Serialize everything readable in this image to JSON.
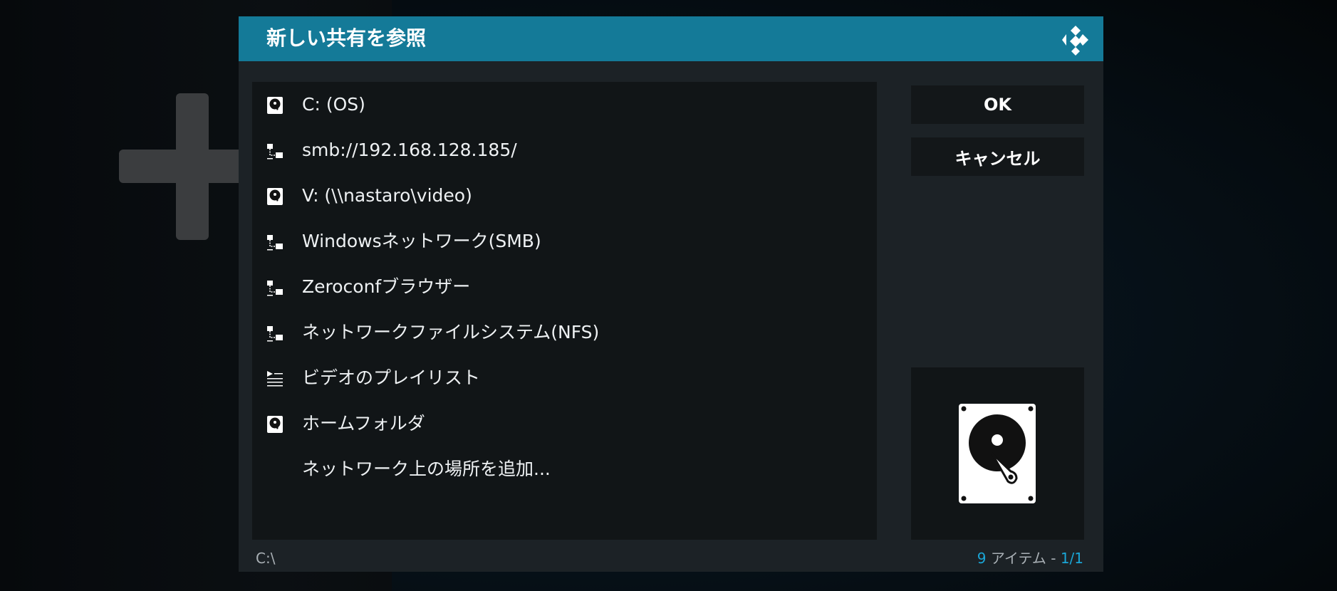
{
  "dialog": {
    "title": "新しい共有を参照",
    "logo_icon": "kodi-logo-icon"
  },
  "list": {
    "items": [
      {
        "label": "C: (OS)",
        "icon": "hard-drive-icon"
      },
      {
        "label": "smb://192.168.128.185/",
        "icon": "network-icon"
      },
      {
        "label": "V: (\\\\nastaro\\video)",
        "icon": "hard-drive-icon"
      },
      {
        "label": "Windowsネットワーク(SMB)",
        "icon": "network-icon"
      },
      {
        "label": "Zeroconfブラウザー",
        "icon": "network-icon"
      },
      {
        "label": "ネットワークファイルシステム(NFS)",
        "icon": "network-icon"
      },
      {
        "label": "ビデオのプレイリスト",
        "icon": "playlist-icon"
      },
      {
        "label": "ホームフォルダ",
        "icon": "hard-drive-icon"
      },
      {
        "label": "ネットワーク上の場所を追加...",
        "icon": ""
      }
    ]
  },
  "buttons": {
    "ok_label": "OK",
    "cancel_label": "キャンセル"
  },
  "preview": {
    "icon": "hard-drive-icon"
  },
  "footer": {
    "path": "C:\\",
    "count_number": "9",
    "count_text": " アイテム - ",
    "page": "1/1"
  },
  "colors": {
    "accent": "#147a98",
    "highlight_text": "#1aa6d6",
    "dialog_bg": "#1c2226",
    "list_bg": "#111517"
  }
}
